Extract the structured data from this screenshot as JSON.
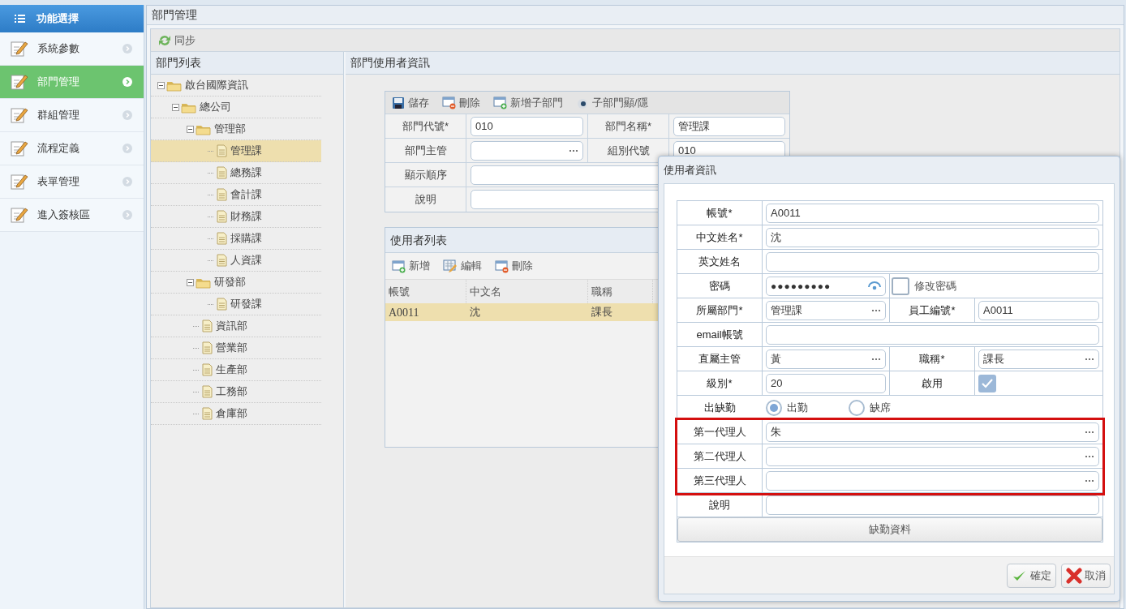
{
  "sidebar": {
    "title": "功能選擇",
    "items": [
      {
        "label": "系統參數",
        "selected": false
      },
      {
        "label": "部門管理",
        "selected": true
      },
      {
        "label": "群組管理",
        "selected": false
      },
      {
        "label": "流程定義",
        "selected": false
      },
      {
        "label": "表單管理",
        "selected": false
      },
      {
        "label": "進入簽核區",
        "selected": false
      }
    ]
  },
  "page": {
    "title": "部門管理",
    "toolbar": [
      {
        "kind": "sync",
        "label": "同步"
      }
    ]
  },
  "tree": {
    "title": "部門列表",
    "items": [
      {
        "label": "啟台國際資訊",
        "selected": false,
        "children": [
          {
            "label": "總公司",
            "selected": false,
            "children": [
              {
                "label": "管理部",
                "selected": false,
                "children": [
                  {
                    "label": "管理課",
                    "selected": true
                  },
                  {
                    "label": "總務課",
                    "selected": false
                  },
                  {
                    "label": "會計課",
                    "selected": false
                  },
                  {
                    "label": "財務課",
                    "selected": false
                  },
                  {
                    "label": "採購課",
                    "selected": false
                  },
                  {
                    "label": "人資課",
                    "selected": false
                  }
                ]
              },
              {
                "label": "研發部",
                "selected": false,
                "children": [
                  {
                    "label": "研發課",
                    "selected": false
                  }
                ]
              },
              {
                "label": "資訊部",
                "selected": false
              },
              {
                "label": "營業部",
                "selected": false
              },
              {
                "label": "生產部",
                "selected": false
              },
              {
                "label": "工務部",
                "selected": false
              },
              {
                "label": "倉庫部",
                "selected": false
              }
            ]
          }
        ]
      }
    ]
  },
  "detail": {
    "title": "部門使用者資訊",
    "dept_toolbar": [
      {
        "kind": "save",
        "label": "儲存"
      },
      {
        "kind": "delete",
        "label": "刪除"
      },
      {
        "kind": "add",
        "label": "新增子部門"
      },
      {
        "kind": "toggle",
        "label": "子部門顯/隱"
      }
    ],
    "dept_form": [
      {
        "label": "部門代號*",
        "field": {
          "kind": "text",
          "value": "010"
        },
        "label2": "部門名稱*",
        "field2": {
          "kind": "text",
          "value": "管理課"
        }
      },
      {
        "label": "部門主管",
        "field": {
          "kind": "picker"
        },
        "label2": "組別代號",
        "field2": {
          "kind": "text",
          "value": "010"
        }
      },
      {
        "label": "顯示順序",
        "field": {
          "kind": "text"
        }
      },
      {
        "label": "說明",
        "field": {
          "kind": "text"
        }
      }
    ],
    "users": {
      "title": "使用者列表",
      "toolbar": [
        {
          "kind": "add",
          "label": "新增"
        },
        {
          "kind": "edit",
          "label": "編輯"
        },
        {
          "kind": "delete",
          "label": "刪除"
        }
      ],
      "columns": [
        "帳號",
        "中文名",
        "職稱"
      ],
      "rows": [
        {
          "cells": [
            "A0011",
            "沈",
            "課長"
          ],
          "selected": true
        }
      ]
    }
  },
  "dialog": {
    "title": "使用者資訊",
    "rows": [
      {
        "label": "帳號*",
        "field": {
          "kind": "text",
          "value": "A0011"
        }
      },
      {
        "label": "中文姓名*",
        "field": {
          "kind": "text",
          "value": "沈"
        }
      },
      {
        "label": "英文姓名",
        "field": {
          "kind": "text"
        }
      },
      {
        "label": "密碼",
        "field": {
          "kind": "password",
          "value": "●●●●●●●●●"
        },
        "extra": {
          "kind": "checkbox",
          "label": "修改密碼",
          "checked": false
        }
      },
      {
        "label": "所屬部門*",
        "field": {
          "kind": "picker",
          "value": "管理課"
        },
        "label2": "員工編號*",
        "field2": {
          "kind": "text",
          "value": "A0011"
        }
      },
      {
        "label": "email帳號",
        "field": {
          "kind": "text"
        }
      },
      {
        "label": "直屬主管",
        "field": {
          "kind": "picker",
          "value": "黃"
        },
        "label2": "職稱*",
        "field2": {
          "kind": "picker",
          "value": "課長"
        }
      },
      {
        "label": "級別*",
        "field": {
          "kind": "text",
          "value": "20"
        },
        "label2": "啟用",
        "field2": {
          "kind": "checkbox",
          "checked": true
        }
      },
      {
        "label": "出缺勤",
        "field": {
          "kind": "radio",
          "options": [
            {
              "label": "出勤",
              "selected": true
            },
            {
              "label": "缺席",
              "selected": false
            }
          ]
        }
      },
      {
        "label": "第一代理人",
        "field": {
          "kind": "picker",
          "value": "朱"
        },
        "highlighted": true
      },
      {
        "label": "第二代理人",
        "field": {
          "kind": "picker"
        },
        "highlighted": true
      },
      {
        "label": "第三代理人",
        "field": {
          "kind": "picker"
        },
        "highlighted": true
      },
      {
        "label": "說明",
        "field": {
          "kind": "text"
        }
      }
    ],
    "wide_button": "缺勤資料",
    "buttons": [
      {
        "kind": "ok",
        "label": "確定"
      },
      {
        "kind": "cancel",
        "label": "取消"
      }
    ]
  }
}
